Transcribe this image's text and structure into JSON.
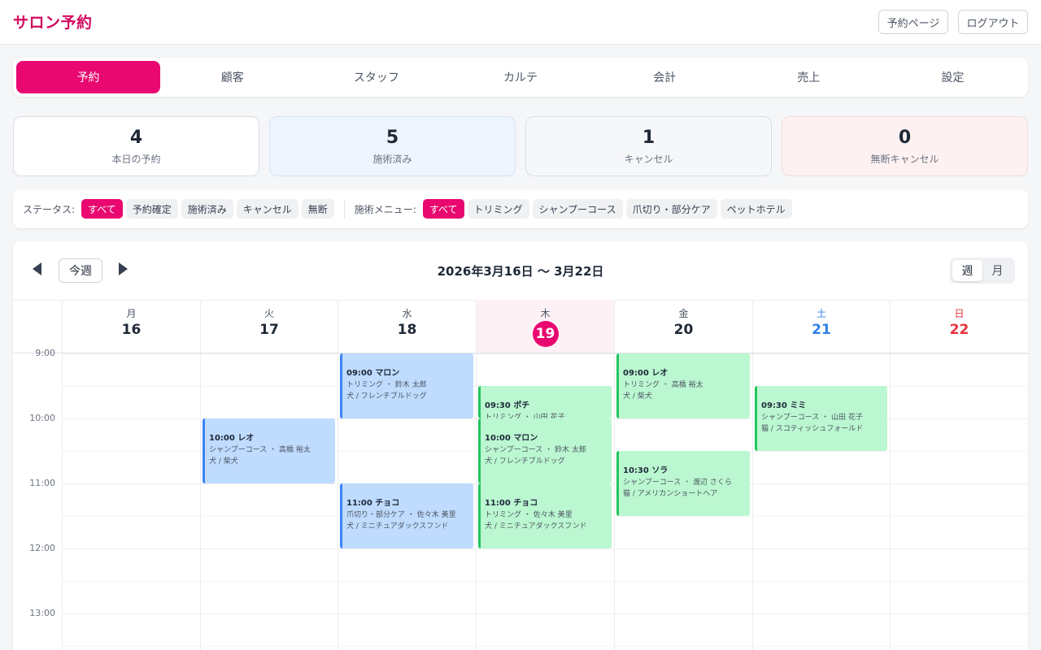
{
  "header": {
    "brand": "サロン予約",
    "booking_page_label": "予約ページ",
    "logout_label": "ログアウト"
  },
  "tabs": [
    {
      "label": "予約",
      "active": true
    },
    {
      "label": "顧客"
    },
    {
      "label": "スタッフ"
    },
    {
      "label": "カルテ"
    },
    {
      "label": "会計"
    },
    {
      "label": "売上"
    },
    {
      "label": "設定"
    }
  ],
  "stats": [
    {
      "value": "4",
      "label": "本日の予約"
    },
    {
      "value": "5",
      "label": "施術済み"
    },
    {
      "value": "1",
      "label": "キャンセル"
    },
    {
      "value": "0",
      "label": "無断キャンセル"
    }
  ],
  "filters": {
    "status_label": "ステータス:",
    "status_options": [
      "すべて",
      "予約確定",
      "施術済み",
      "キャンセル",
      "無断"
    ],
    "status_selected": "すべて",
    "menu_label": "施術メニュー:",
    "menu_options": [
      "すべて",
      "トリミング",
      "シャンプーコース",
      "爪切り・部分ケア",
      "ペットホテル"
    ],
    "menu_selected": "すべて"
  },
  "calendar": {
    "today_button": "今週",
    "range": "2026年3月16日 〜 3月22日",
    "view_week": "週",
    "view_month": "月",
    "view_selected": "週",
    "days": [
      {
        "weekday": "月",
        "date": "16"
      },
      {
        "weekday": "火",
        "date": "17"
      },
      {
        "weekday": "水",
        "date": "18"
      },
      {
        "weekday": "木",
        "date": "19",
        "today": true
      },
      {
        "weekday": "金",
        "date": "20"
      },
      {
        "weekday": "土",
        "date": "21",
        "kind": "sat"
      },
      {
        "weekday": "日",
        "date": "22",
        "kind": "sun"
      }
    ],
    "time_labels": [
      "9:00",
      "10:00",
      "11:00",
      "12:00",
      "13:00"
    ],
    "appointments": [
      {
        "day": 1,
        "start": "10:00",
        "end": "11:00",
        "title": "10:00 レオ",
        "menu": "シャンプーコース ・ 高橋 裕太",
        "pet": "犬 / 柴犬",
        "color": "blue"
      },
      {
        "day": 2,
        "start": "09:00",
        "end": "10:00",
        "title": "09:00 マロン",
        "menu": "トリミング ・ 鈴木 太郎",
        "pet": "犬 / フレンチブルドッグ",
        "color": "blue"
      },
      {
        "day": 2,
        "start": "11:00",
        "end": "12:00",
        "title": "11:00 チョコ",
        "menu": "爪切り・部分ケア ・ 佐々木 美里",
        "pet": "犬 / ミニチュアダックスフンド",
        "color": "blue"
      },
      {
        "day": 3,
        "start": "09:30",
        "end": "10:00",
        "title": "09:30 ポチ",
        "menu": "トリミング ・ 山田 花子",
        "pet": "",
        "color": "green"
      },
      {
        "day": 3,
        "start": "10:00",
        "end": "11:00",
        "title": "10:00 マロン",
        "menu": "シャンプーコース ・ 鈴木 太郎",
        "pet": "犬 / フレンチブルドッグ",
        "color": "green"
      },
      {
        "day": 3,
        "start": "11:00",
        "end": "12:00",
        "title": "11:00 チョコ",
        "menu": "トリミング ・ 佐々木 美里",
        "pet": "犬 / ミニチュアダックスフンド",
        "color": "green"
      },
      {
        "day": 4,
        "start": "09:00",
        "end": "10:00",
        "title": "09:00 レオ",
        "menu": "トリミング ・ 高橋 裕太",
        "pet": "犬 / 柴犬",
        "color": "green"
      },
      {
        "day": 4,
        "start": "10:30",
        "end": "11:30",
        "title": "10:30 ソラ",
        "menu": "シャンプーコース ・ 渡辺 さくら",
        "pet": "猫 / アメリカンショートヘア",
        "color": "green"
      },
      {
        "day": 5,
        "start": "09:30",
        "end": "10:30",
        "title": "09:30 ミミ",
        "menu": "シャンプーコース ・ 山田 花子",
        "pet": "猫 / スコティッシュフォールド",
        "color": "green"
      }
    ]
  }
}
